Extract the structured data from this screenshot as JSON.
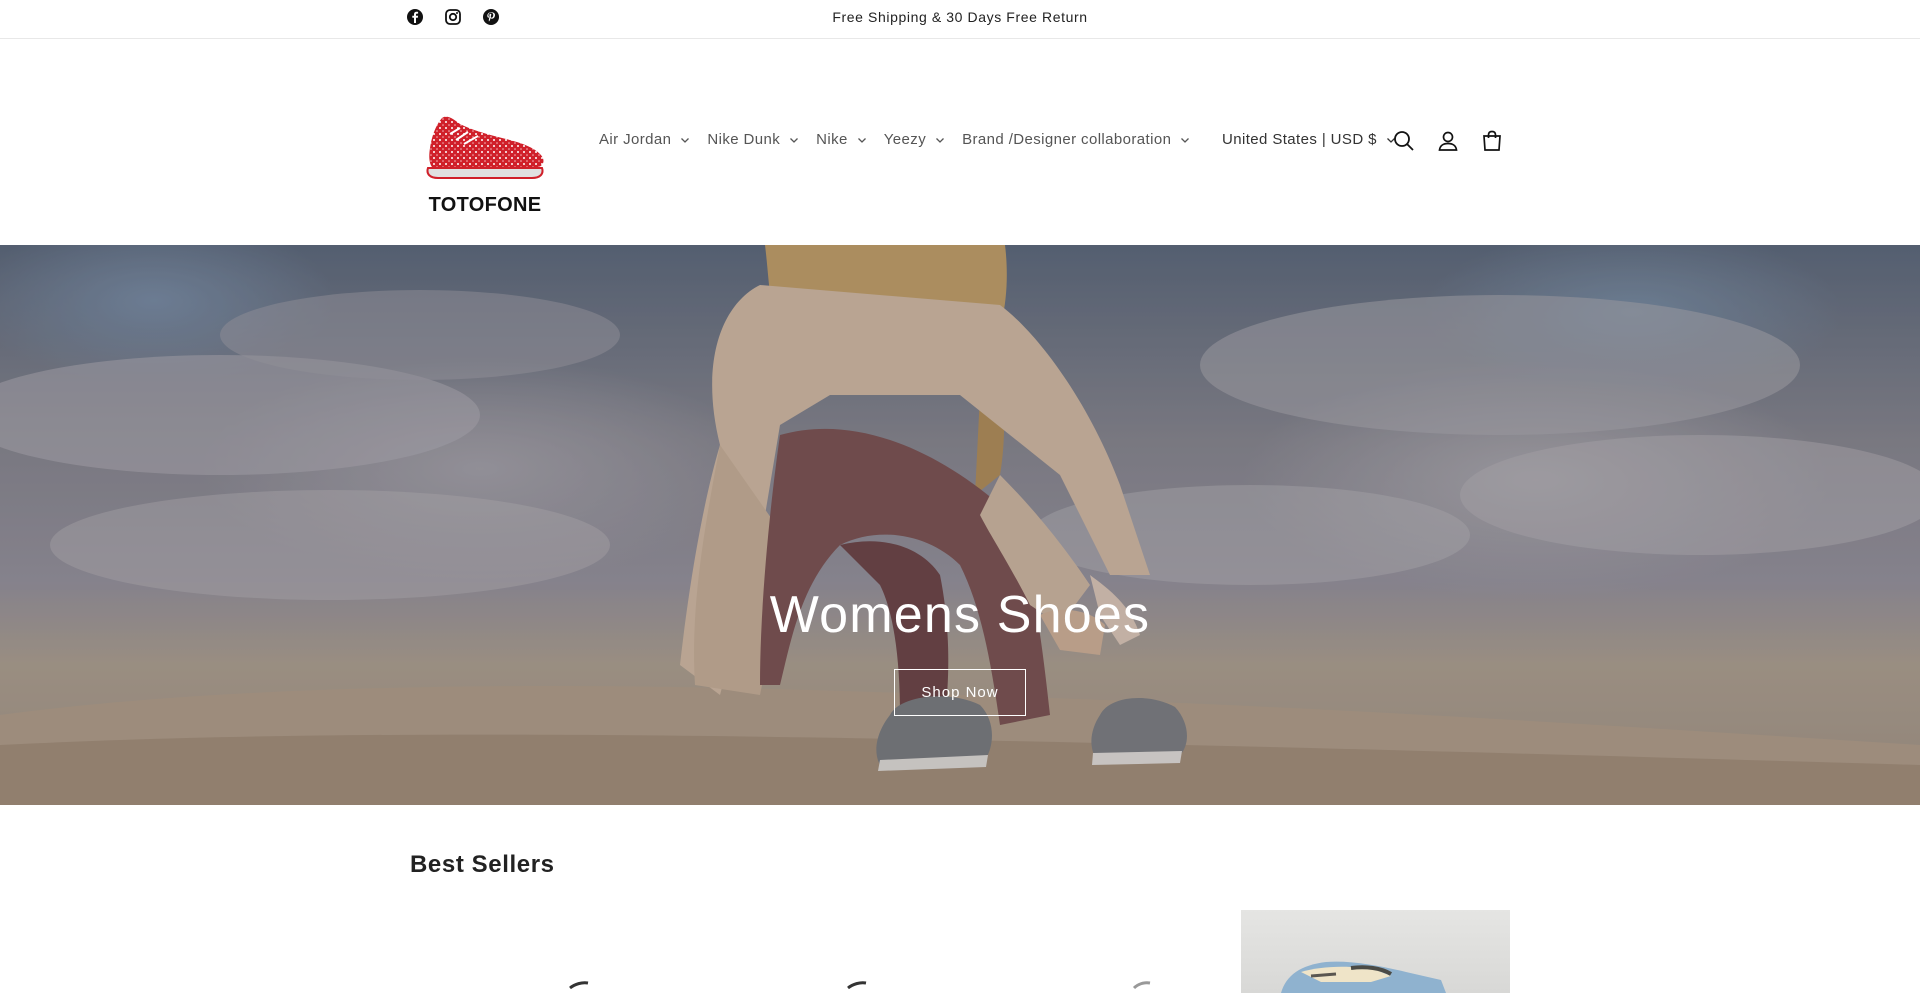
{
  "announcement": {
    "text": "Free Shipping & 30 Days Free Return",
    "social_icons": [
      "facebook-icon",
      "instagram-icon",
      "pinterest-icon"
    ]
  },
  "header": {
    "logo_text": "TOTOFONE",
    "nav": [
      {
        "label": "Air Jordan"
      },
      {
        "label": "Nike Dunk"
      },
      {
        "label": "Nike"
      },
      {
        "label": "Yeezy"
      },
      {
        "label": "Brand /Designer collaboration"
      }
    ],
    "country_selector": "United States | USD $",
    "icons": [
      "search-icon",
      "account-icon",
      "cart-icon"
    ]
  },
  "hero": {
    "title": "Womens Shoes",
    "button_label": "Shop Now"
  },
  "best_sellers": {
    "title": "Best Sellers",
    "product_count_visible": 4
  },
  "colors": {
    "logo_red": "#d0202a",
    "text": "#121212",
    "nav_text": "#555555"
  }
}
